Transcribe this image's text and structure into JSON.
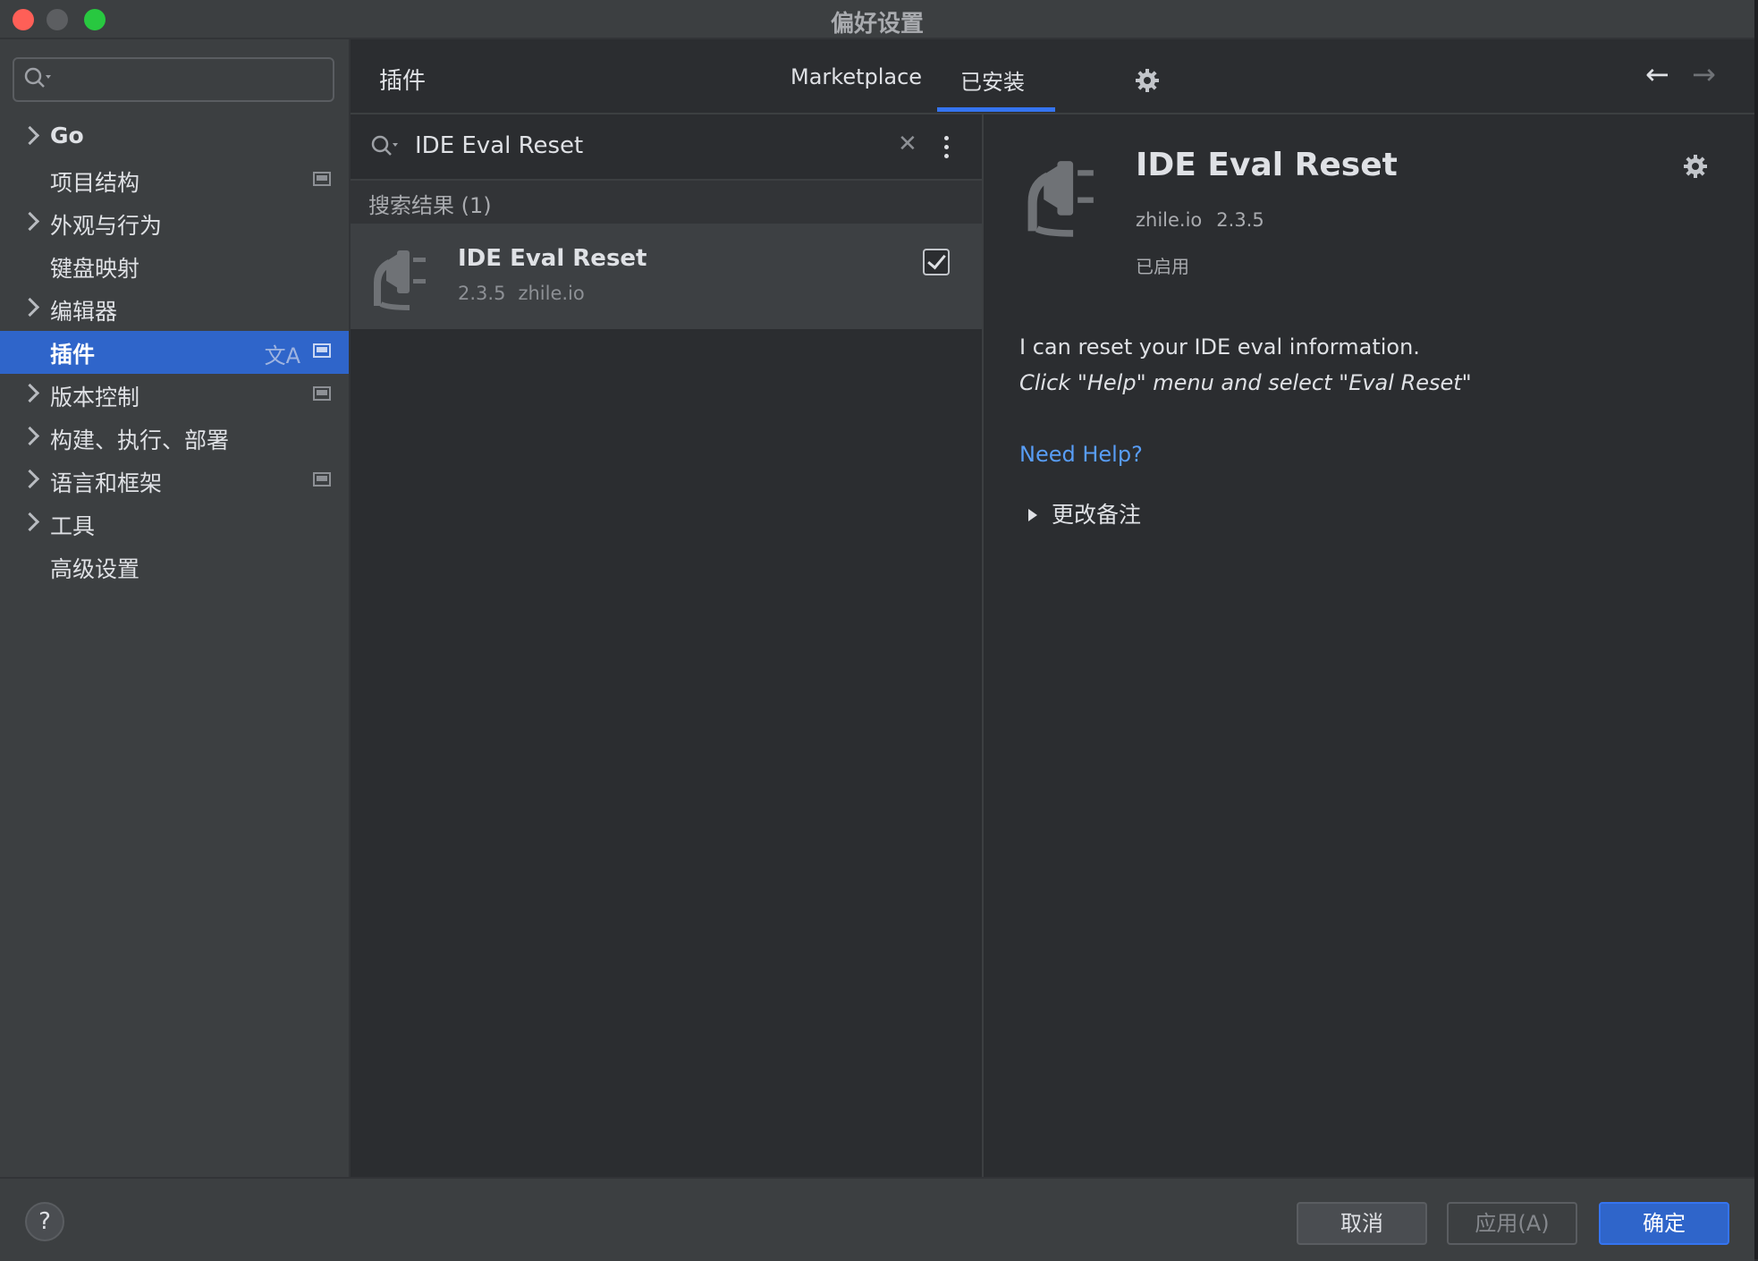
{
  "window": {
    "title": "偏好设置"
  },
  "sidebar": {
    "search_placeholder": "",
    "items": [
      {
        "label": "Go",
        "expandable": true,
        "project_icon": false,
        "selected": false
      },
      {
        "label": "项目结构",
        "expandable": false,
        "project_icon": true,
        "selected": false
      },
      {
        "label": "外观与行为",
        "expandable": true,
        "project_icon": false,
        "selected": false
      },
      {
        "label": "键盘映射",
        "expandable": false,
        "project_icon": false,
        "selected": false
      },
      {
        "label": "编辑器",
        "expandable": true,
        "project_icon": false,
        "selected": false
      },
      {
        "label": "插件",
        "expandable": false,
        "project_icon": true,
        "selected": true
      },
      {
        "label": "版本控制",
        "expandable": true,
        "project_icon": true,
        "selected": false
      },
      {
        "label": "构建、执行、部署",
        "expandable": true,
        "project_icon": false,
        "selected": false
      },
      {
        "label": "语言和框架",
        "expandable": true,
        "project_icon": true,
        "selected": false
      },
      {
        "label": "工具",
        "expandable": true,
        "project_icon": false,
        "selected": false
      },
      {
        "label": "高级设置",
        "expandable": false,
        "project_icon": false,
        "selected": false
      }
    ]
  },
  "header": {
    "title": "插件",
    "tabs": [
      {
        "label": "Marketplace",
        "active": false
      },
      {
        "label": "已安装",
        "active": true
      }
    ]
  },
  "search": {
    "query": "IDE Eval Reset",
    "results_label": "搜索结果 (1)"
  },
  "results": [
    {
      "name": "IDE Eval Reset",
      "version": "2.3.5",
      "vendor": "zhile.io",
      "enabled": true
    }
  ],
  "detail": {
    "name": "IDE Eval Reset",
    "vendor": "zhile.io",
    "version": "2.3.5",
    "status": "已启用",
    "description_line1": "I can reset your IDE eval information.",
    "description_line2": "Click \"Help\" menu and select \"Eval Reset\"",
    "help_link": "Need Help?",
    "change_notes": "更改备注"
  },
  "footer": {
    "help": "?",
    "cancel": "取消",
    "apply": "应用(A)",
    "ok": "确定"
  },
  "colors": {
    "accent": "#3574f0",
    "selection": "#2f65ca",
    "link": "#589df6",
    "background": "#2b2d30"
  }
}
